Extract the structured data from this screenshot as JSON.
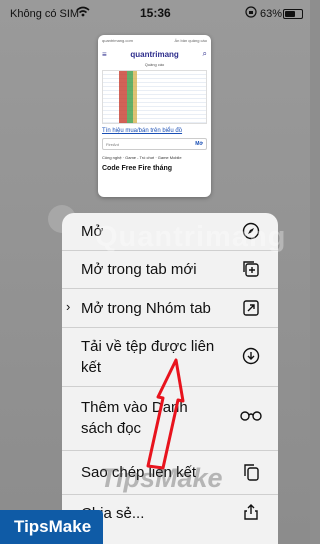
{
  "status_bar": {
    "carrier": "Không có SIM",
    "time": "15:36",
    "battery": "63%"
  },
  "preview": {
    "site": "quantrimang.com",
    "ad_label": "Ẩn bản quảng cáo",
    "logo": "quantrimang",
    "sub_title": "Quảng cáo",
    "headline": "Tín hiệu mua/bán trên biểu đồ",
    "input_text": "FireAnt",
    "input_action": "Mở",
    "tags": "Công nghệ  ·  Game - Trò chơi  ·  Game Mobile",
    "article_title": "Code Free Fire tháng"
  },
  "menu": {
    "items": [
      {
        "label": "Mở",
        "icon": "compass-icon"
      },
      {
        "label": "Mở trong tab mới",
        "icon": "plus-square-icon"
      },
      {
        "label": "Mở trong Nhóm tab",
        "icon": "arrow-square-icon"
      },
      {
        "label": "Tải về tệp được liên kết",
        "icon": "download-circle-icon"
      },
      {
        "label": "Thêm vào Danh sách đọc",
        "icon": "glasses-icon"
      },
      {
        "label": "Sao chép liên kết",
        "icon": "copy-icon"
      },
      {
        "label": "Chia sẻ...",
        "icon": "share-icon"
      }
    ]
  },
  "watermark": "Quantrimang",
  "watermark2": "TipsMake",
  "badge": "TipsMake",
  "accent_color": "#e8131d"
}
